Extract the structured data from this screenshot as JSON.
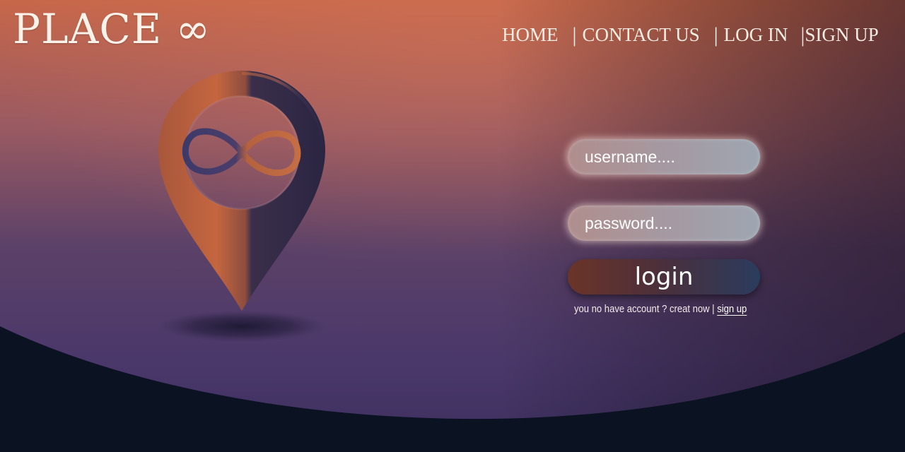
{
  "brand": {
    "logo_text": "PLACE ∞"
  },
  "nav": {
    "items": [
      {
        "label": "HOME"
      },
      {
        "label": "CONTACT US"
      },
      {
        "label": "LOG IN"
      },
      {
        "label": "SIGN UP"
      }
    ],
    "separator": "|"
  },
  "login_form": {
    "username_placeholder": "username....",
    "password_placeholder": "password....",
    "login_label": "login",
    "signup_prompt": "you no have account ? creat now",
    "signup_separator": "|",
    "signup_link": "sign up"
  },
  "colors": {
    "bg_top": "#c4674a",
    "bg_mid": "#5c3f66",
    "bg_bottom_purple": "#4a386a",
    "dark_wave": "#0b1222",
    "pin_orange": "#b15b3c",
    "pin_navy": "#2e2a48"
  },
  "icons": {
    "pin": "location-pin-infinity-icon"
  }
}
